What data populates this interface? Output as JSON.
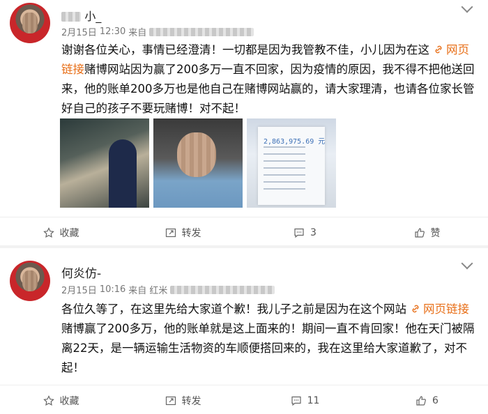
{
  "posts": [
    {
      "user": {
        "name": "小_"
      },
      "meta": {
        "date": "2月15日",
        "time": "12:30",
        "from_prefix": "来自"
      },
      "content": {
        "before_link": "谢谢各位关心，事情已经澄清！一切都是因为我管教不佳，小儿因为在这",
        "link_text": "网页链接",
        "after_link": "赌博网站因为赢了200多万一直不回家，因为疫情的原因，我不得不把他送回来，他的账单200多万也是他自己在赌博网站赢的，请大家理清，也请各位家长管好自己的孩子不要玩赌博！对不起！"
      },
      "photos": [
        {
          "icon": "photo-train"
        },
        {
          "icon": "photo-selfie"
        },
        {
          "icon": "photo-statement",
          "amount": "2,863,975.69 元"
        }
      ],
      "actions": {
        "collect": "收藏",
        "repost": "转发",
        "comments": "3",
        "likes": "赞"
      }
    },
    {
      "user": {
        "name": "何炎仿-"
      },
      "meta": {
        "date": "2月15日",
        "time": "10:16",
        "from_prefix": "来自",
        "source_partial": "红米"
      },
      "content": {
        "before_link": "各位久等了，在这里先给大家道个歉！我儿子之前是因为在这个网站",
        "link_text": "网页链接",
        "after_link": "赌博赢了200多万，他的账单就是这上面来的！期间一直不肯回家！他在天门被隔离22天，是一辆运输生活物资的车顺便搭回来的，我在这里给大家道歉了，对不起！"
      },
      "actions": {
        "collect": "收藏",
        "repost": "转发",
        "comments": "11",
        "likes": "6"
      }
    }
  ],
  "colors": {
    "link": "#e8701a",
    "background": "#f2f2f2"
  }
}
